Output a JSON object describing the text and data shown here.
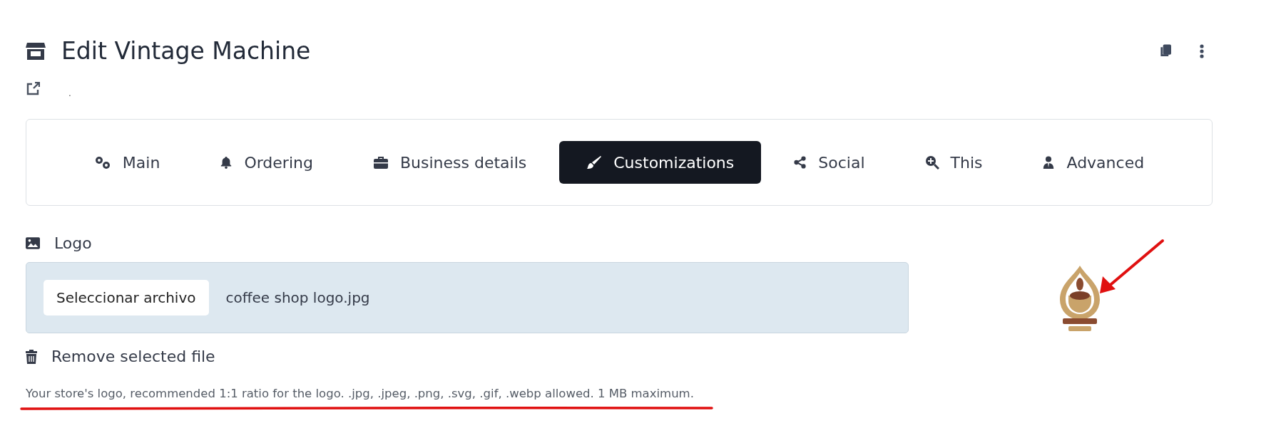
{
  "header": {
    "title": "Edit Vintage Machine",
    "subtitle": "."
  },
  "tabs": [
    {
      "label": "Main",
      "selected": false
    },
    {
      "label": "Ordering",
      "selected": false
    },
    {
      "label": "Business details",
      "selected": false
    },
    {
      "label": "Customizations",
      "selected": true
    },
    {
      "label": "Social",
      "selected": false
    },
    {
      "label": "This",
      "selected": false
    },
    {
      "label": "Advanced",
      "selected": false
    }
  ],
  "logo_field": {
    "label": "Logo",
    "button": "Seleccionar archivo",
    "value": "coffee shop logo.jpg",
    "remove": "Remove selected file",
    "help": "Your store's logo, recommended 1:1 ratio for the logo. .jpg, .jpeg, .png, .svg, .gif, .webp allowed. 1 MB maximum."
  }
}
